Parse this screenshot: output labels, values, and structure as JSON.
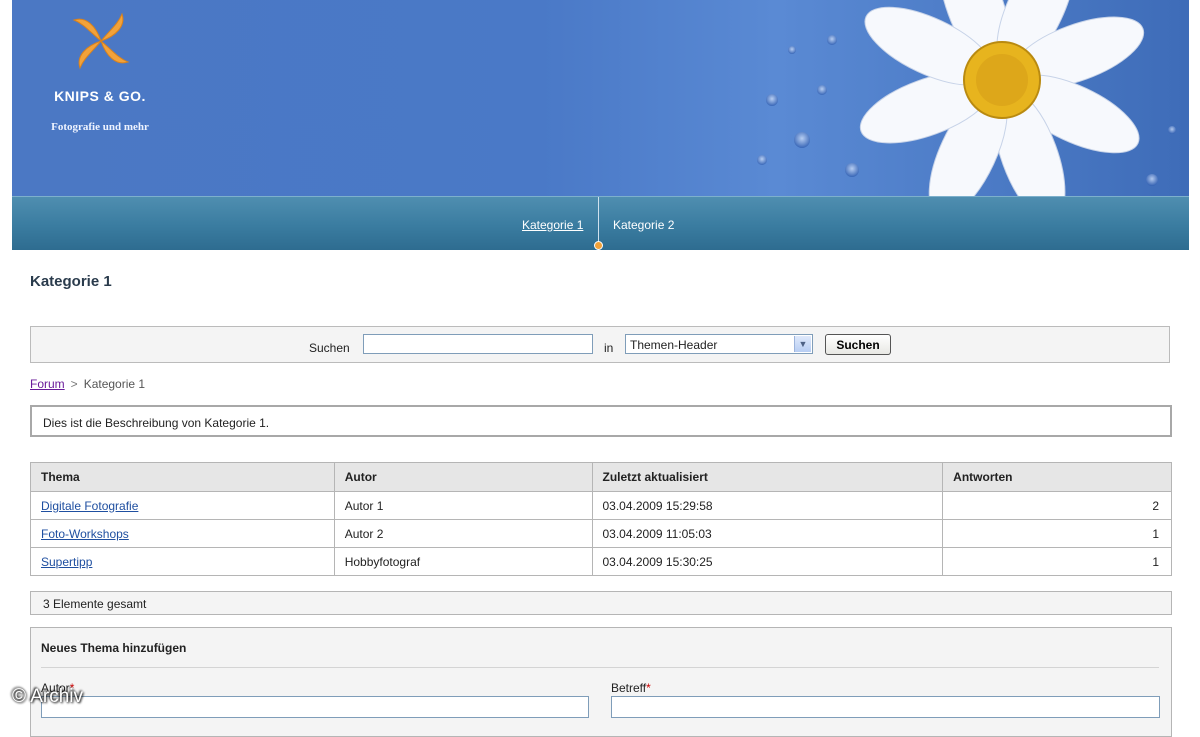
{
  "header": {
    "brand_title": "KNIPS & GO.",
    "brand_subtitle": "Fotografie und mehr"
  },
  "nav": {
    "items": [
      {
        "label": "Kategorie 1",
        "active": true
      },
      {
        "label": "Kategorie 2",
        "active": false
      }
    ]
  },
  "page": {
    "title": "Kategorie 1"
  },
  "search": {
    "label": "Suchen",
    "value": "",
    "in_label": "in",
    "scope_selected": "Themen-Header",
    "button_label": "Suchen"
  },
  "breadcrumb": {
    "root": "Forum",
    "separator": ">",
    "current": "Kategorie 1"
  },
  "description": "Dies ist die Beschreibung von Kategorie 1.",
  "table": {
    "headers": [
      "Thema",
      "Autor",
      "Zuletzt aktualisiert",
      "Antworten"
    ],
    "rows": [
      {
        "thema": "Digitale Fotografie",
        "autor": "Autor 1",
        "updated": "03.04.2009 15:29:58",
        "antworten": "2"
      },
      {
        "thema": "Foto-Workshops",
        "autor": "Autor 2",
        "updated": "03.04.2009 11:05:03",
        "antworten": "1"
      },
      {
        "thema": "Supertipp",
        "autor": "Hobbyfotograf",
        "updated": "03.04.2009 15:30:25",
        "antworten": "1"
      }
    ]
  },
  "total": "3 Elemente gesamt",
  "new_topic": {
    "title": "Neues Thema hinzufügen",
    "author_label": "Autor",
    "subject_label": "Betreff",
    "required_mark": "*"
  },
  "watermark": "© Archiv",
  "colors": {
    "header_blue": "#4b78c4",
    "nav_teal": "#3a7ca0",
    "link_blue": "#1f4fa0",
    "visited_purple": "#6a1b9a",
    "logo_orange": "#f2a23a"
  }
}
